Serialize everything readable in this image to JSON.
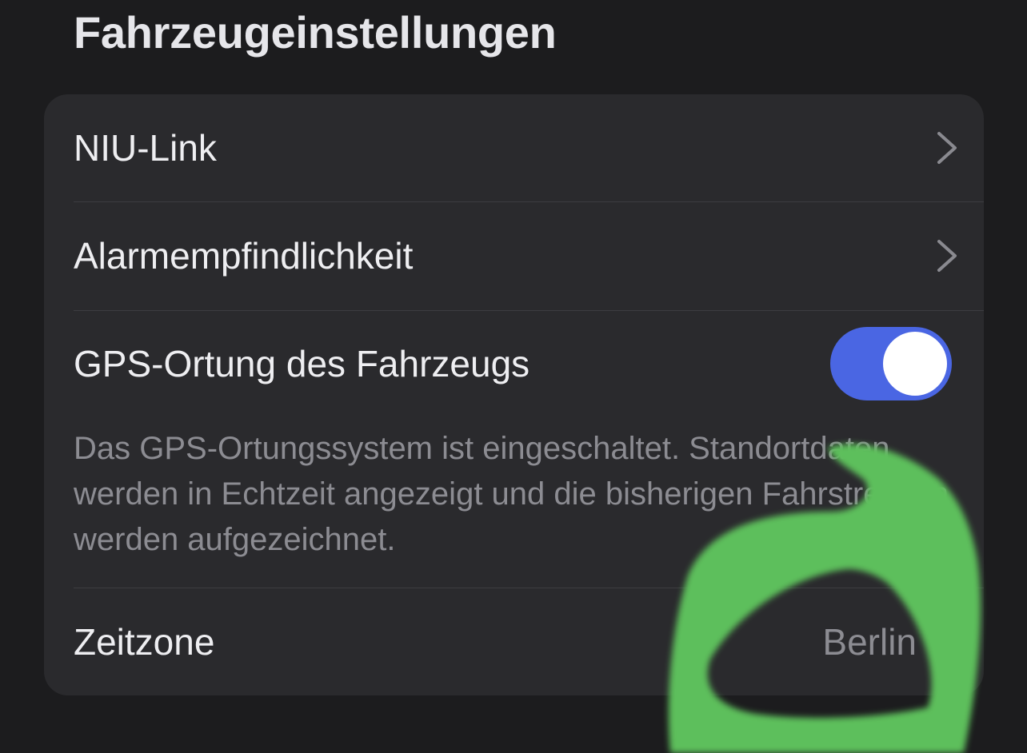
{
  "section": {
    "title": "Fahrzeugeinstellungen"
  },
  "rows": {
    "niu_link": {
      "label": "NIU-Link",
      "icon": "chevron-right-icon"
    },
    "alarm": {
      "label": "Alarmempfindlichkeit",
      "icon": "chevron-right-icon"
    },
    "gps": {
      "label": "GPS-Ortung des Fahrzeugs",
      "toggle_state": "on",
      "description": "Das GPS-Ortungssystem ist eingeschaltet. Standortdaten werden in Echtzeit angezeigt und die bisherigen Fahrstrecken werden aufgezeichnet."
    },
    "zeitzone": {
      "label": "Zeitzone",
      "value": "Berlin",
      "icon": "chevron-right-icon"
    }
  },
  "colors": {
    "background": "#1c1c1e",
    "card": "#2a2a2d",
    "toggle_on": "#4a66e3",
    "secondary_text": "#8c8c92",
    "overlay_mark": "#5dbf5c"
  }
}
